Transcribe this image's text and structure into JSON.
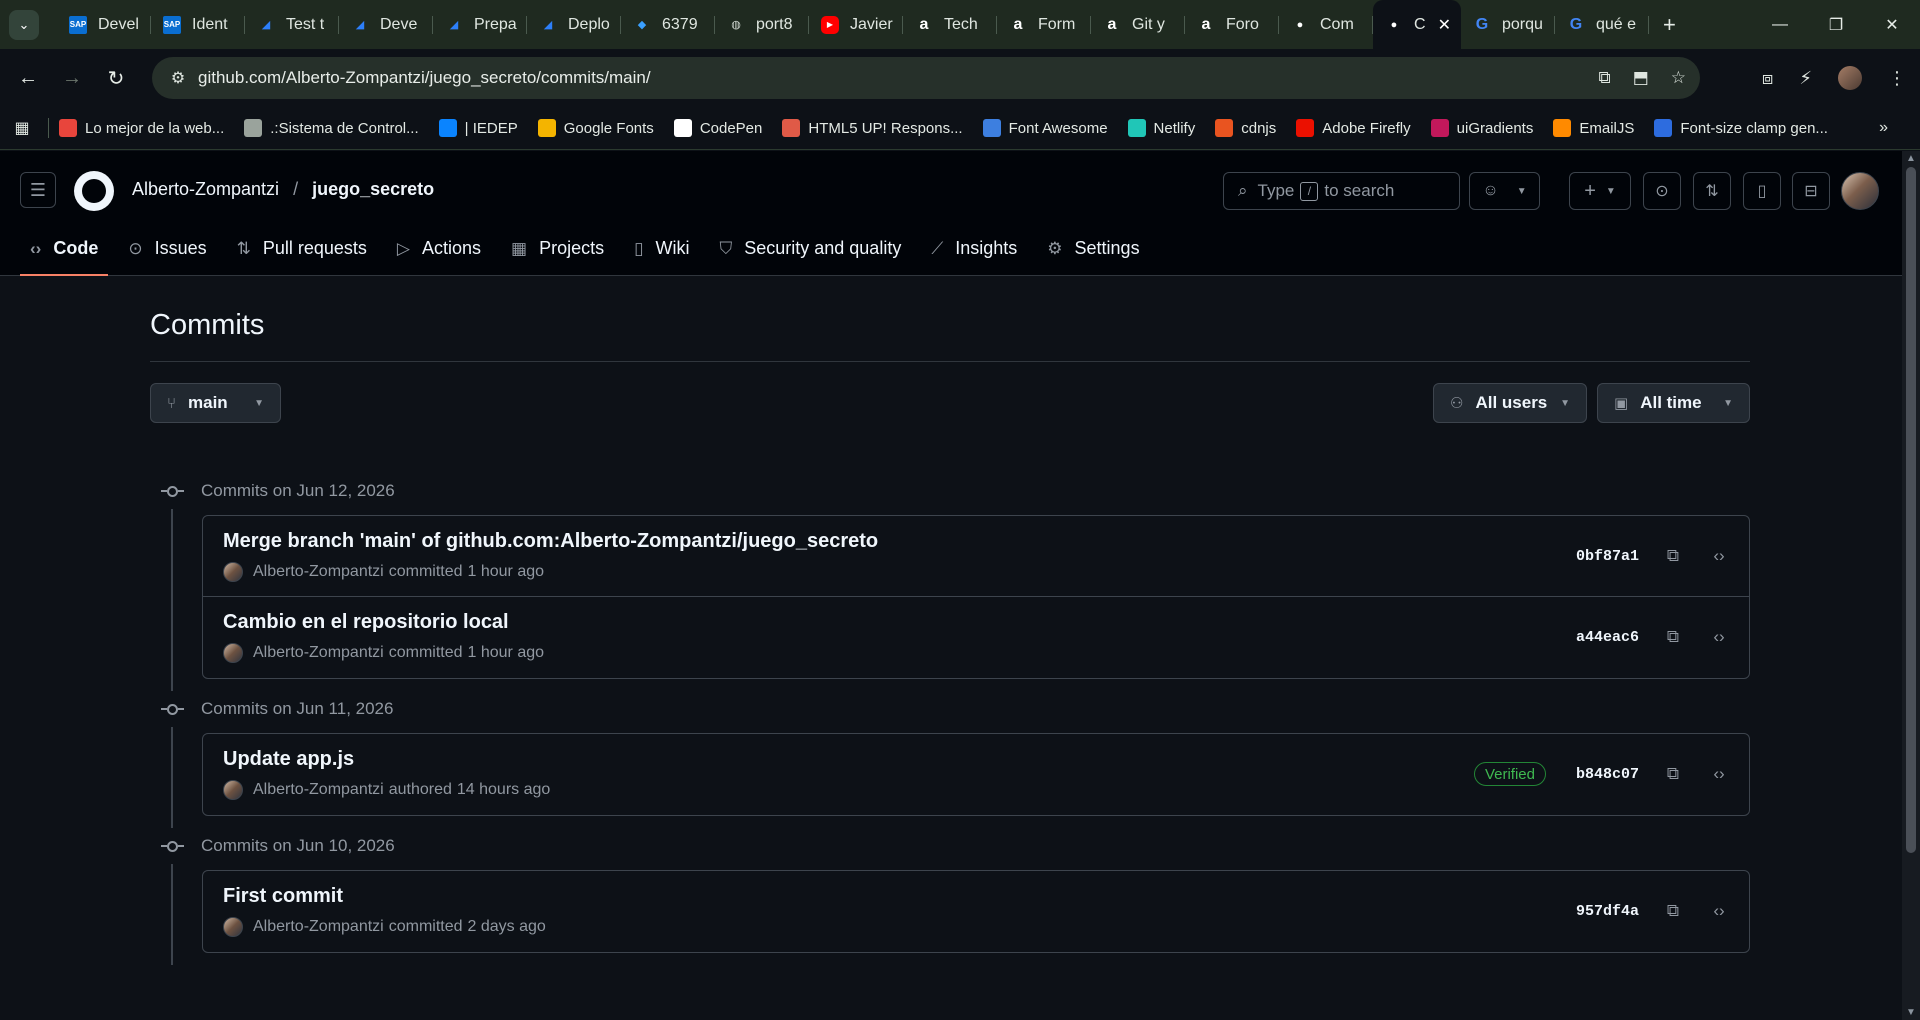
{
  "browser": {
    "tabs": [
      {
        "title": "Devel",
        "icon": "sap"
      },
      {
        "title": "Ident",
        "icon": "sap"
      },
      {
        "title": "Test t",
        "icon": "flag"
      },
      {
        "title": "Deve",
        "icon": "flag"
      },
      {
        "title": "Prepa",
        "icon": "flag"
      },
      {
        "title": "Deplo",
        "icon": "flag"
      },
      {
        "title": "6379",
        "icon": "azure"
      },
      {
        "title": "port8",
        "icon": "globe"
      },
      {
        "title": "Javier",
        "icon": "youtube"
      },
      {
        "title": "Tech",
        "icon": "a"
      },
      {
        "title": "Form",
        "icon": "a"
      },
      {
        "title": "Git y",
        "icon": "a"
      },
      {
        "title": "Foro",
        "icon": "a"
      },
      {
        "title": "Com",
        "icon": "github"
      },
      {
        "title": "C",
        "icon": "github",
        "active": true
      },
      {
        "title": "porqu",
        "icon": "google"
      },
      {
        "title": "qué e",
        "icon": "google"
      }
    ],
    "url": "github.com/Alberto-Zompantzi/juego_secreto/commits/main/",
    "bookmarks": [
      {
        "label": "Lo mejor de la web...",
        "color": "#e8453c"
      },
      {
        "label": ".:Sistema de Control...",
        "color": "#9aa39c"
      },
      {
        "label": "| IEDEP",
        "color": "#0a84ff"
      },
      {
        "label": "Google Fonts",
        "color": "#f4b400"
      },
      {
        "label": "CodePen",
        "color": "#ffffff"
      },
      {
        "label": "HTML5 UP! Respons...",
        "color": "#e05a47"
      },
      {
        "label": "Font Awesome",
        "color": "#3d7fe0"
      },
      {
        "label": "Netlify",
        "color": "#20c6b7"
      },
      {
        "label": "cdnjs",
        "color": "#e95420"
      },
      {
        "label": "Adobe Firefly",
        "color": "#eb1000"
      },
      {
        "label": "uiGradients",
        "color": "#c2185b"
      },
      {
        "label": "EmailJS",
        "color": "#ff8a00"
      },
      {
        "label": "Font-size clamp gen...",
        "color": "#2d6cdf"
      }
    ]
  },
  "header": {
    "owner": "Alberto-Zompantzi",
    "separator": "/",
    "repo": "juego_secreto",
    "search_prefix": "Type",
    "search_key": "/",
    "search_suffix": "to search"
  },
  "repo_nav": [
    {
      "label": "Code",
      "icon": "code-icon",
      "glyph": "‹›",
      "active": true
    },
    {
      "label": "Issues",
      "icon": "issue-icon",
      "glyph": "⊙"
    },
    {
      "label": "Pull requests",
      "icon": "pull-request-icon",
      "glyph": "⇅"
    },
    {
      "label": "Actions",
      "icon": "play-icon",
      "glyph": "▷"
    },
    {
      "label": "Projects",
      "icon": "table-icon",
      "glyph": "▦"
    },
    {
      "label": "Wiki",
      "icon": "book-icon",
      "glyph": "▯"
    },
    {
      "label": "Security and quality",
      "icon": "shield-icon",
      "glyph": "⛉"
    },
    {
      "label": "Insights",
      "icon": "graph-icon",
      "glyph": "⟋"
    },
    {
      "label": "Settings",
      "icon": "gear-icon",
      "glyph": "⚙"
    }
  ],
  "page": {
    "title": "Commits",
    "branch": "main",
    "users_filter": "All users",
    "time_filter": "All time"
  },
  "commit_groups": [
    {
      "heading": "Commits on Jun 12, 2026",
      "commits": [
        {
          "title": "Merge branch 'main' of github.com:Alberto-Zompantzi/juego_secreto",
          "author": "Alberto-Zompantzi",
          "action": "committed",
          "time": "1 hour ago",
          "sha": "0bf87a1",
          "verified": ""
        },
        {
          "title": "Cambio en el repositorio local",
          "author": "Alberto-Zompantzi",
          "action": "committed",
          "time": "1 hour ago",
          "sha": "a44eac6",
          "verified": ""
        }
      ]
    },
    {
      "heading": "Commits on Jun 11, 2026",
      "commits": [
        {
          "title": "Update app.js",
          "author": "Alberto-Zompantzi",
          "action": "authored",
          "time": "14 hours ago",
          "sha": "b848c07",
          "verified": "Verified"
        }
      ]
    },
    {
      "heading": "Commits on Jun 10, 2026",
      "commits": [
        {
          "title": "First commit",
          "author": "Alberto-Zompantzi",
          "action": "committed",
          "time": "2 days ago",
          "sha": "957df4a",
          "verified": ""
        }
      ]
    }
  ]
}
